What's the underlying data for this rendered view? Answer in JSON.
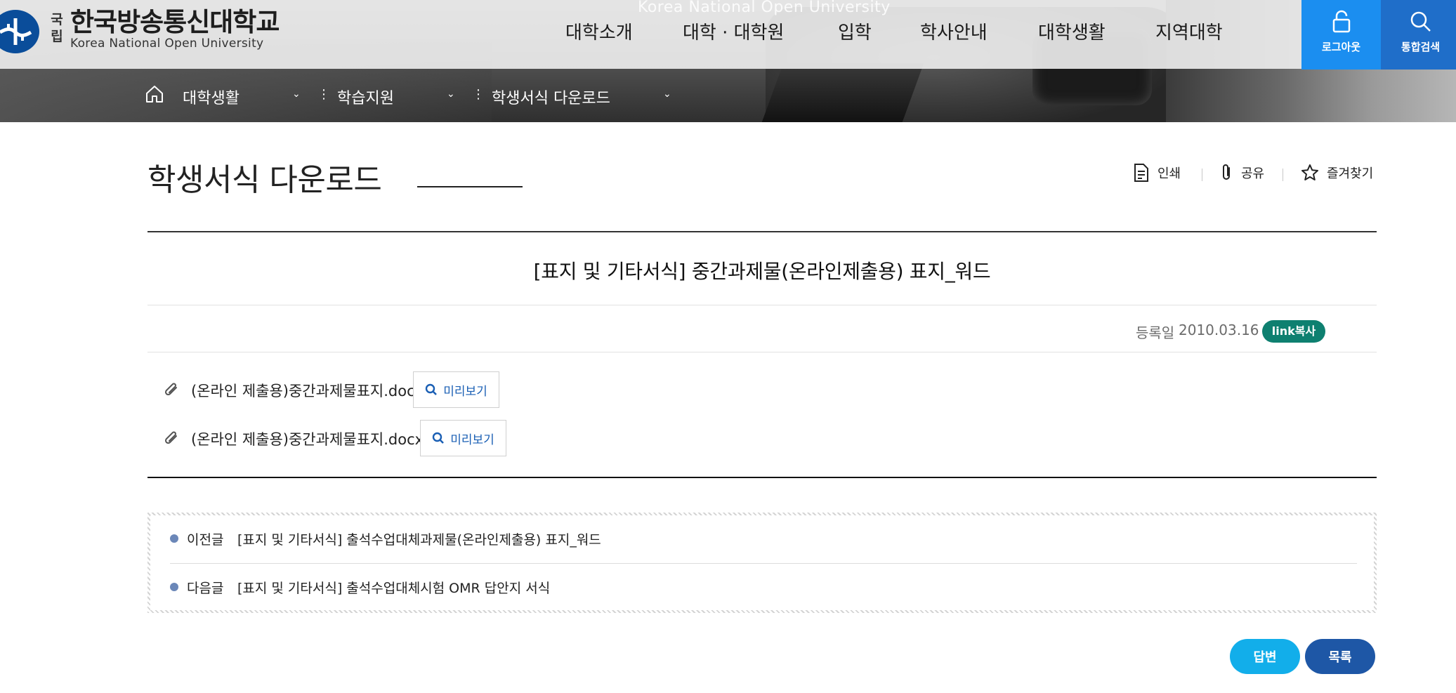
{
  "header": {
    "brand_caption": "Korea National Open University",
    "logo": {
      "prefix": "국립",
      "title": "한국방송통신대학교",
      "subtitle": "Korea National Open University"
    },
    "nav": [
      {
        "label": "대학소개"
      },
      {
        "label": "대학 · 대학원"
      },
      {
        "label": "입학"
      },
      {
        "label": "학사안내"
      },
      {
        "label": "대학생활"
      },
      {
        "label": "지역대학"
      }
    ],
    "logout_label": "로그아웃",
    "search_label": "통합검색"
  },
  "breadcrumb": {
    "items": [
      {
        "label": "대학생활"
      },
      {
        "label": "학습지원"
      },
      {
        "label": "학생서식 다운로드"
      }
    ]
  },
  "page": {
    "title": "학생서식 다운로드",
    "tools": {
      "print": "인쇄",
      "share": "공유",
      "favorite": "즐겨찾기"
    }
  },
  "post": {
    "title": "[표지 및 기타서식] 중간과제물(온라인제출용) 표지_워드",
    "date_label": "등록일",
    "date": "2010.03.16",
    "link_copy": "link복사",
    "files": [
      {
        "name": "(온라인 제출용)중간과제물표지.doc",
        "preview": "미리보기"
      },
      {
        "name": "(온라인 제출용)중간과제물표지.docx",
        "preview": "미리보기"
      }
    ]
  },
  "prev_next": {
    "prev_label": "이전글",
    "prev_title": "[표지 및 기타서식] 출석수업대체과제물(온라인제출용) 표지_워드",
    "next_label": "다음글",
    "next_title": "[표지 및 기타서식] 출석수업대체시험 OMR 답안지 서식"
  },
  "buttons": {
    "reply": "답변",
    "list": "목록"
  },
  "colors": {
    "logout_bg": "#1b8ef0",
    "search_bg": "#1f6ec9",
    "link_copy_bg": "#0e8070",
    "reply_bg": "#12aeea",
    "list_bg": "#1e57a6"
  }
}
